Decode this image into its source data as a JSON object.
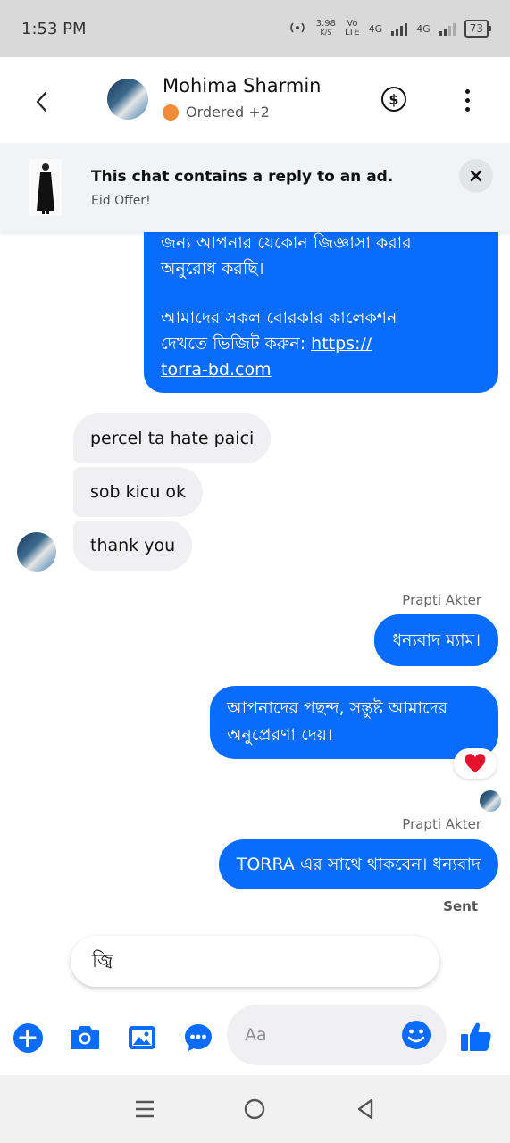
{
  "status_bar": {
    "time": "1:53 PM",
    "net_speed_value": "3.98",
    "net_speed_unit": "K/S",
    "volte_top": "Vo",
    "volte_bottom": "LTE",
    "sim1_net": "4G",
    "sim2_net": "4G",
    "battery": "73"
  },
  "header": {
    "contact_name": "Mohima Sharmin",
    "status_text": "Ordered +2",
    "status_color": "#f28c38"
  },
  "ad_banner": {
    "title": "This chat contains a reply to an ad.",
    "subtitle": "Eid Offer!"
  },
  "messages": {
    "outgoing_big": {
      "line1": "জন্য আপনার যেকোন জিজ্ঞাসা করার",
      "line2": "অনুরোধ করছি।",
      "line3": "আমাদের সকল  বোরকার কালেকশন",
      "line4_prefix": "দেখতে ভিজিট করুন: ",
      "link_part1": "https://",
      "link_part2": "torra-bd.com"
    },
    "incoming": [
      {
        "text": "percel ta hate paici"
      },
      {
        "text": "sob kicu ok"
      },
      {
        "text": "thank you"
      }
    ],
    "sender_label_1": "Prapti Akter",
    "outgoing_1": "ধন্যবাদ ম্যাম।",
    "outgoing_2": "আপনাদের পছন্দ,  সন্তুষ্ট আমাদের অনুপ্রেরণা দেয়।",
    "reaction": "heart",
    "sender_label_2": "Prapti Akter",
    "outgoing_3": "TORRA এর সাথে থাকবেন। ধন্যবাদ",
    "sent_status": "Sent"
  },
  "suggestion": {
    "text": "জ্বি"
  },
  "composer": {
    "placeholder": "Aa",
    "accent_color": "#0a6cff"
  }
}
